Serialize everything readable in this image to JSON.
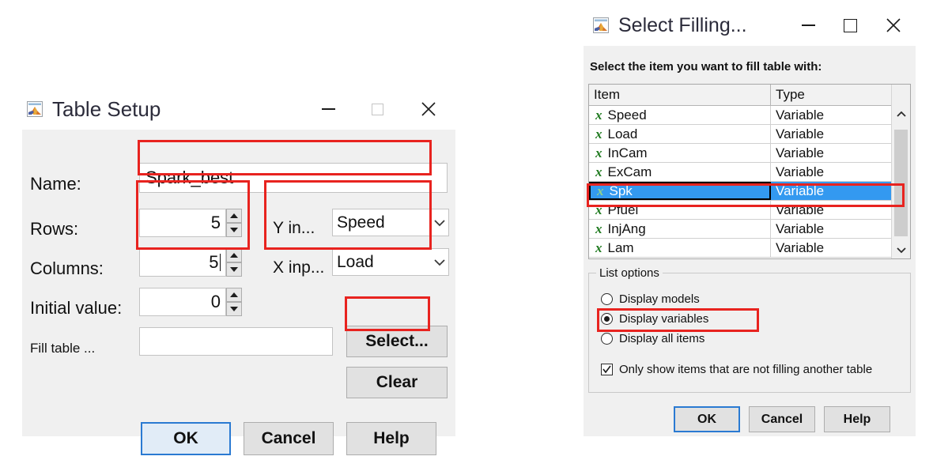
{
  "table_setup": {
    "title": "Table Setup",
    "icon": "matlab-icon",
    "window_buttons": {
      "minimize": "—",
      "maximize": "□",
      "close": "✕"
    },
    "fields": {
      "name_label": "Name:",
      "name_value": "Spark_best",
      "rows_label": "Rows:",
      "rows_value": "5",
      "columns_label": "Columns:",
      "columns_value": "5",
      "initial_label": "Initial value:",
      "initial_value": "0",
      "fill_label": "Fill table ...",
      "fill_value": "",
      "y_input_label": "Y in...",
      "y_input_value": "Speed",
      "x_input_label": "X inp...",
      "x_input_value": "Load"
    },
    "buttons": {
      "select": "Select...",
      "clear": "Clear",
      "ok": "OK",
      "cancel": "Cancel",
      "help": "Help"
    }
  },
  "select_filling": {
    "title": "Select Filling...",
    "icon": "matlab-icon",
    "window_buttons": {
      "minimize": "—",
      "maximize": "□",
      "close": "✕"
    },
    "prompt": "Select the item you want to fill table with:",
    "list": {
      "headers": [
        "Item",
        "Type"
      ],
      "rows": [
        {
          "item": "Speed",
          "type": "Variable",
          "icon": "variable-x-icon",
          "selected": false
        },
        {
          "item": "Load",
          "type": "Variable",
          "icon": "variable-x-icon",
          "selected": false
        },
        {
          "item": "InCam",
          "type": "Variable",
          "icon": "variable-x-icon",
          "selected": false
        },
        {
          "item": "ExCam",
          "type": "Variable",
          "icon": "variable-x-icon",
          "selected": false
        },
        {
          "item": "Spk",
          "type": "Variable",
          "icon": "variable-x-icon",
          "selected": true
        },
        {
          "item": "Pfuel",
          "type": "Variable",
          "icon": "variable-x-icon",
          "selected": false
        },
        {
          "item": "InjAng",
          "type": "Variable",
          "icon": "variable-x-icon",
          "selected": false
        },
        {
          "item": "Lam",
          "type": "Variable",
          "icon": "variable-x-icon",
          "selected": false
        }
      ]
    },
    "options": {
      "group_title": "List options",
      "radios": [
        {
          "label": "Display models",
          "checked": false
        },
        {
          "label": "Display variables",
          "checked": true
        },
        {
          "label": "Display all items",
          "checked": false
        }
      ],
      "checkbox": {
        "label": "Only show items that are not filling another table",
        "checked": true
      }
    },
    "buttons": {
      "ok": "OK",
      "cancel": "Cancel",
      "help": "Help"
    }
  },
  "colors": {
    "dialog_bg": "#f0f0f0",
    "highlight": "#3399f0",
    "annotation_red": "#e8231f",
    "default_button_border": "#2a7ad2",
    "variable_icon_green": "#1f7a1f"
  }
}
